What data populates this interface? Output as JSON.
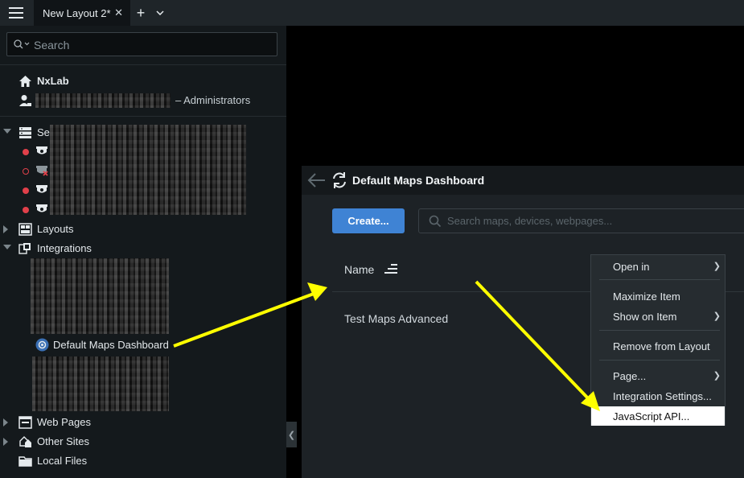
{
  "tabs": {
    "active_label": "New Layout 2*",
    "close_glyph": "✕",
    "add_glyph": "+"
  },
  "sidebar": {
    "search_placeholder": "Search",
    "site_name": "NxLab",
    "user_role": "– Administrators",
    "server_name": "Server NX",
    "layouts_label": "Layouts",
    "integrations_label": "Integrations",
    "integration_item": "Default Maps Dashboard",
    "web_pages_label": "Web Pages",
    "other_sites_label": "Other Sites",
    "local_files_label": "Local Files",
    "camera_status": [
      "recording",
      "offline",
      "recording",
      "recording"
    ]
  },
  "panel": {
    "title": "Default Maps Dashboard",
    "create_button": "Create...",
    "search_placeholder": "Search maps, devices, webpages...",
    "column_name": "Name",
    "rows": [
      "Test Maps Advanced"
    ]
  },
  "context_menu": {
    "items": [
      {
        "label": "Open in",
        "submenu": true
      },
      {
        "label": "Maximize Item",
        "submenu": false
      },
      {
        "label": "Show on Item",
        "submenu": true
      },
      {
        "label": "Remove from Layout",
        "submenu": false
      },
      {
        "label": "Page...",
        "submenu": true
      },
      {
        "label": "Integration Settings...",
        "submenu": false
      },
      {
        "label": "JavaScript API...",
        "submenu": false
      }
    ],
    "highlighted": "JavaScript API..."
  },
  "colors": {
    "accent": "#3f83d4",
    "annotation_arrow": "#ffff00",
    "status_red": "#e0404a"
  },
  "collapse_glyph": "❮"
}
